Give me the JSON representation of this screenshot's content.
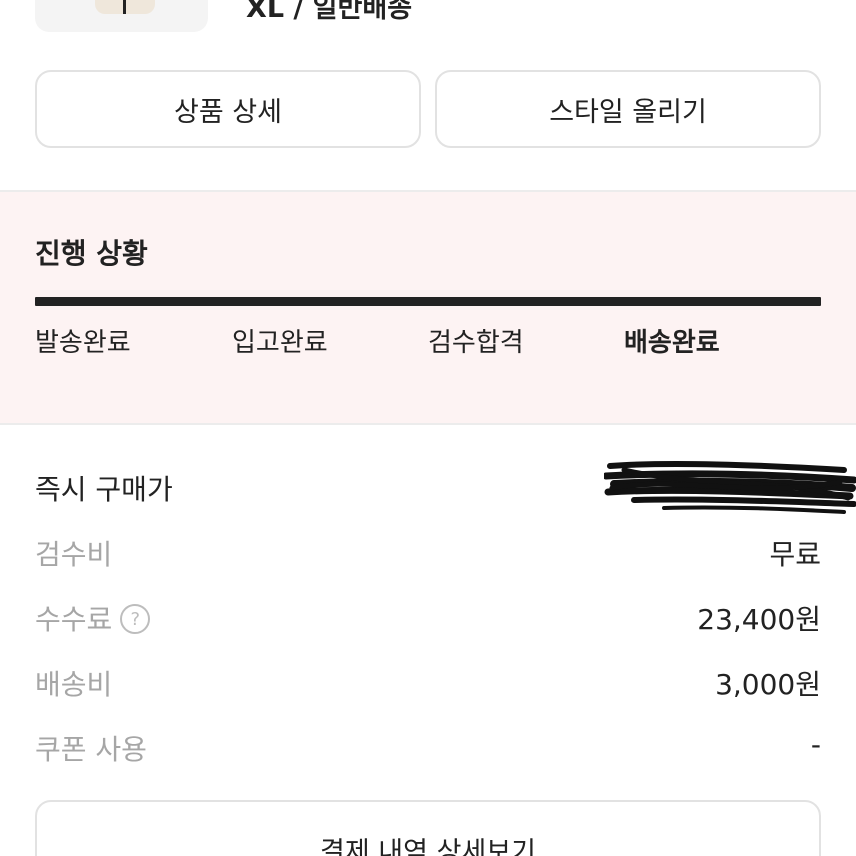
{
  "product": {
    "option_text": "XL / 일반배송"
  },
  "actions": {
    "product_detail_label": "상품 상세",
    "post_style_label": "스타일 올리기"
  },
  "progress": {
    "title": "진행 상황",
    "steps": [
      {
        "label": "발송완료",
        "active": false
      },
      {
        "label": "입고완료",
        "active": false
      },
      {
        "label": "검수합격",
        "active": false
      },
      {
        "label": "배송완료",
        "active": true
      }
    ]
  },
  "price": {
    "instant_buy_label": "즉시 구매가",
    "instant_buy_value": "",
    "inspection_fee_label": "검수비",
    "inspection_fee_value": "무료",
    "commission_label": "수수료",
    "commission_help_symbol": "?",
    "commission_value": "23,400원",
    "shipping_label": "배송비",
    "shipping_value": "3,000원",
    "coupon_label": "쿠폰 사용",
    "coupon_value": "-"
  },
  "footer": {
    "payment_detail_label": "결제 내역 상세보기"
  },
  "colors": {
    "progress_background": "#fdf3f3",
    "progress_bar": "#222222",
    "muted_text": "#a6a6a6"
  },
  "icons": {
    "help": "question-circle-icon"
  }
}
